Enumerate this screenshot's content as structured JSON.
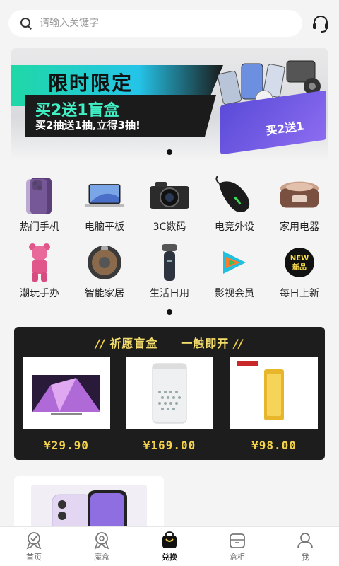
{
  "search": {
    "placeholder": "请输入关键字"
  },
  "banner": {
    "title": "限时限定",
    "subtitle": "买2送1盲盒",
    "tagline": "买2抽送1抽,立得3抽!",
    "box_label": "买2送1"
  },
  "categories": [
    {
      "label": "热门手机",
      "icon": "phone-icon"
    },
    {
      "label": "电脑平板",
      "icon": "laptop-icon"
    },
    {
      "label": "3C数码",
      "icon": "camera-icon"
    },
    {
      "label": "电竞外设",
      "icon": "gaming-mouse-icon"
    },
    {
      "label": "家用电器",
      "icon": "rice-cooker-icon"
    },
    {
      "label": "潮玩手办",
      "icon": "bear-figure-icon"
    },
    {
      "label": "智能家居",
      "icon": "robot-vacuum-icon"
    },
    {
      "label": "生活日用",
      "icon": "shaver-icon"
    },
    {
      "label": "影视会员",
      "icon": "video-play-icon"
    },
    {
      "label": "每日上新",
      "icon": "new-badge-icon"
    }
  ],
  "blind_box": {
    "title": "祈愿盲盒",
    "subtitle": "一触即开",
    "products": [
      {
        "price": "¥29.90",
        "icon": "tv-icon"
      },
      {
        "price": "¥169.00",
        "icon": "air-purifier-icon"
      },
      {
        "price": "¥98.00",
        "icon": "gold-bar-icon"
      }
    ]
  },
  "tabbar": [
    {
      "label": "首页",
      "icon": "home-medal-icon",
      "active": false
    },
    {
      "label": "魔盒",
      "icon": "magic-box-icon",
      "active": false
    },
    {
      "label": "兑换",
      "icon": "shopping-bag-icon",
      "active": true
    },
    {
      "label": "盒柜",
      "icon": "cabinet-icon",
      "active": false
    },
    {
      "label": "我",
      "icon": "user-icon",
      "active": false
    }
  ],
  "colors": {
    "accent": "#f4d24a",
    "dark_panel": "#1d1d1d",
    "teal": "#1fd8a6",
    "box_purple": "#6a55e0"
  }
}
